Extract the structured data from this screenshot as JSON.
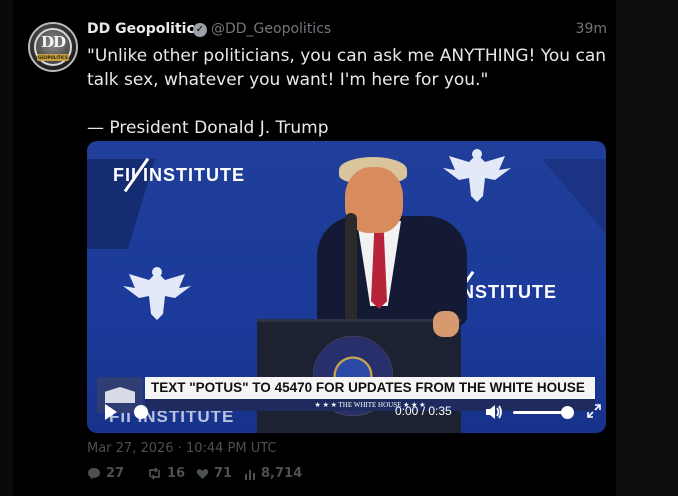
{
  "tweet": {
    "author_name": "DD Geopolitics",
    "author_handle": "@DD_Geopolitics",
    "relative_time": "39m",
    "avatar_monogram": "DD",
    "avatar_ribbon": "GEOPOLITICS",
    "text_line1": "\"Unlike other politicians, you can ask me ANYTHING! You can talk sex, whatever you want! I'm here for you.\"",
    "text_line2": "— President Donald J. Trump",
    "timestamp": "Mar 27, 2026 · 10:44 PM UTC"
  },
  "video": {
    "logo_text_1": "FII INSTITUTE",
    "logo_text_2": "INSTITUTE",
    "logo_text_3": "FII INSTITUTE",
    "banner_headline": "TEXT \"POTUS\" TO 45470 FOR UPDATES FROM THE WHITE HOUSE",
    "banner_sub": "★ ★ ★   THE WHITE HOUSE   ★ ★ ★",
    "time_readout": "0:00 / 0:35",
    "progress": 0.0,
    "volume": 0.9
  },
  "stats": {
    "replies": "27",
    "retweets": "16",
    "likes": "71",
    "views": "8,714"
  },
  "colors": {
    "background": "#000000",
    "text": "#e7e9ea",
    "muted": "#71767b",
    "stats": "#4b5054",
    "video_blue": "#1c3b9c"
  }
}
